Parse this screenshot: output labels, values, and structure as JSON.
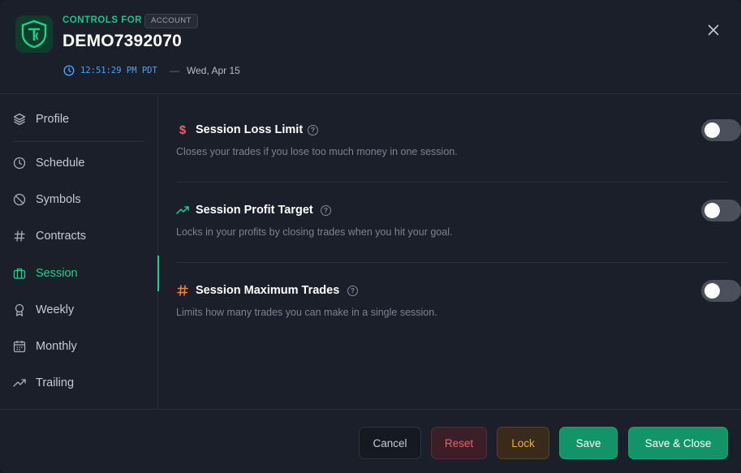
{
  "header": {
    "controls_for": "CONTROLS FOR",
    "badge": "ACCOUNT",
    "account_id": "DEMO7392070",
    "time": "12:51:29 PM PDT",
    "separator": "—",
    "date": "Wed, Apr 15",
    "accent_color": "#19c48a"
  },
  "sidebar": {
    "items": [
      {
        "label": "Profile",
        "icon": "layers-icon"
      },
      {
        "label": "Schedule",
        "icon": "clock-icon"
      },
      {
        "label": "Symbols",
        "icon": "ban-icon"
      },
      {
        "label": "Contracts",
        "icon": "hash-icon"
      },
      {
        "label": "Session",
        "icon": "briefcase-icon",
        "active": true
      },
      {
        "label": "Weekly",
        "icon": "award-icon"
      },
      {
        "label": "Monthly",
        "icon": "calendar-icon"
      },
      {
        "label": "Trailing",
        "icon": "trending-up-icon"
      }
    ]
  },
  "settings": [
    {
      "title": "Session Loss Limit",
      "description": "Closes your trades if you lose too much money in one session.",
      "icon": "dollar-icon",
      "enabled": false
    },
    {
      "title": "Session Profit Target",
      "description": "Locks in your profits by closing trades when you hit your goal.",
      "icon": "trending-up-icon",
      "enabled": false
    },
    {
      "title": "Session Maximum Trades",
      "description": "Limits how many trades you can make in a single session.",
      "icon": "hash-icon",
      "enabled": false
    }
  ],
  "footer": {
    "cancel": "Cancel",
    "reset": "Reset",
    "lock": "Lock",
    "save": "Save",
    "save_close": "Save & Close"
  }
}
